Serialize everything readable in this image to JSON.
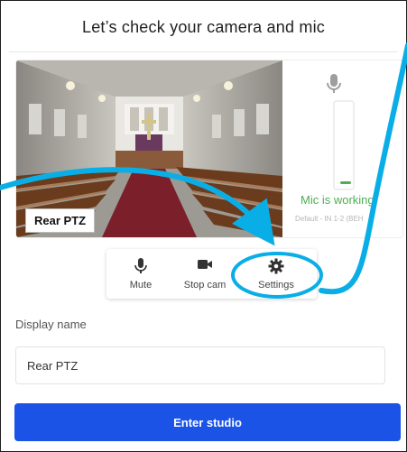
{
  "dialog": {
    "title": "Let’s check your camera and mic"
  },
  "preview": {
    "source_label": "Rear PTZ"
  },
  "mic": {
    "status": "Mic is working",
    "device": "Default - IN 1-2 (BEH",
    "level": 0.03,
    "status_color": "#4caf50"
  },
  "controls": {
    "mute_label": "Mute",
    "stop_label": "Stop cam",
    "settings_label": "Settings",
    "mute_icon": "mic-icon",
    "stop_icon": "video-camera-icon",
    "settings_icon": "gear-icon"
  },
  "display_name": {
    "label": "Display name",
    "value": "Rear PTZ"
  },
  "enter_button": {
    "label": "Enter studio",
    "color": "#1a53e6"
  },
  "annotation": {
    "color": "#0aaee6"
  }
}
